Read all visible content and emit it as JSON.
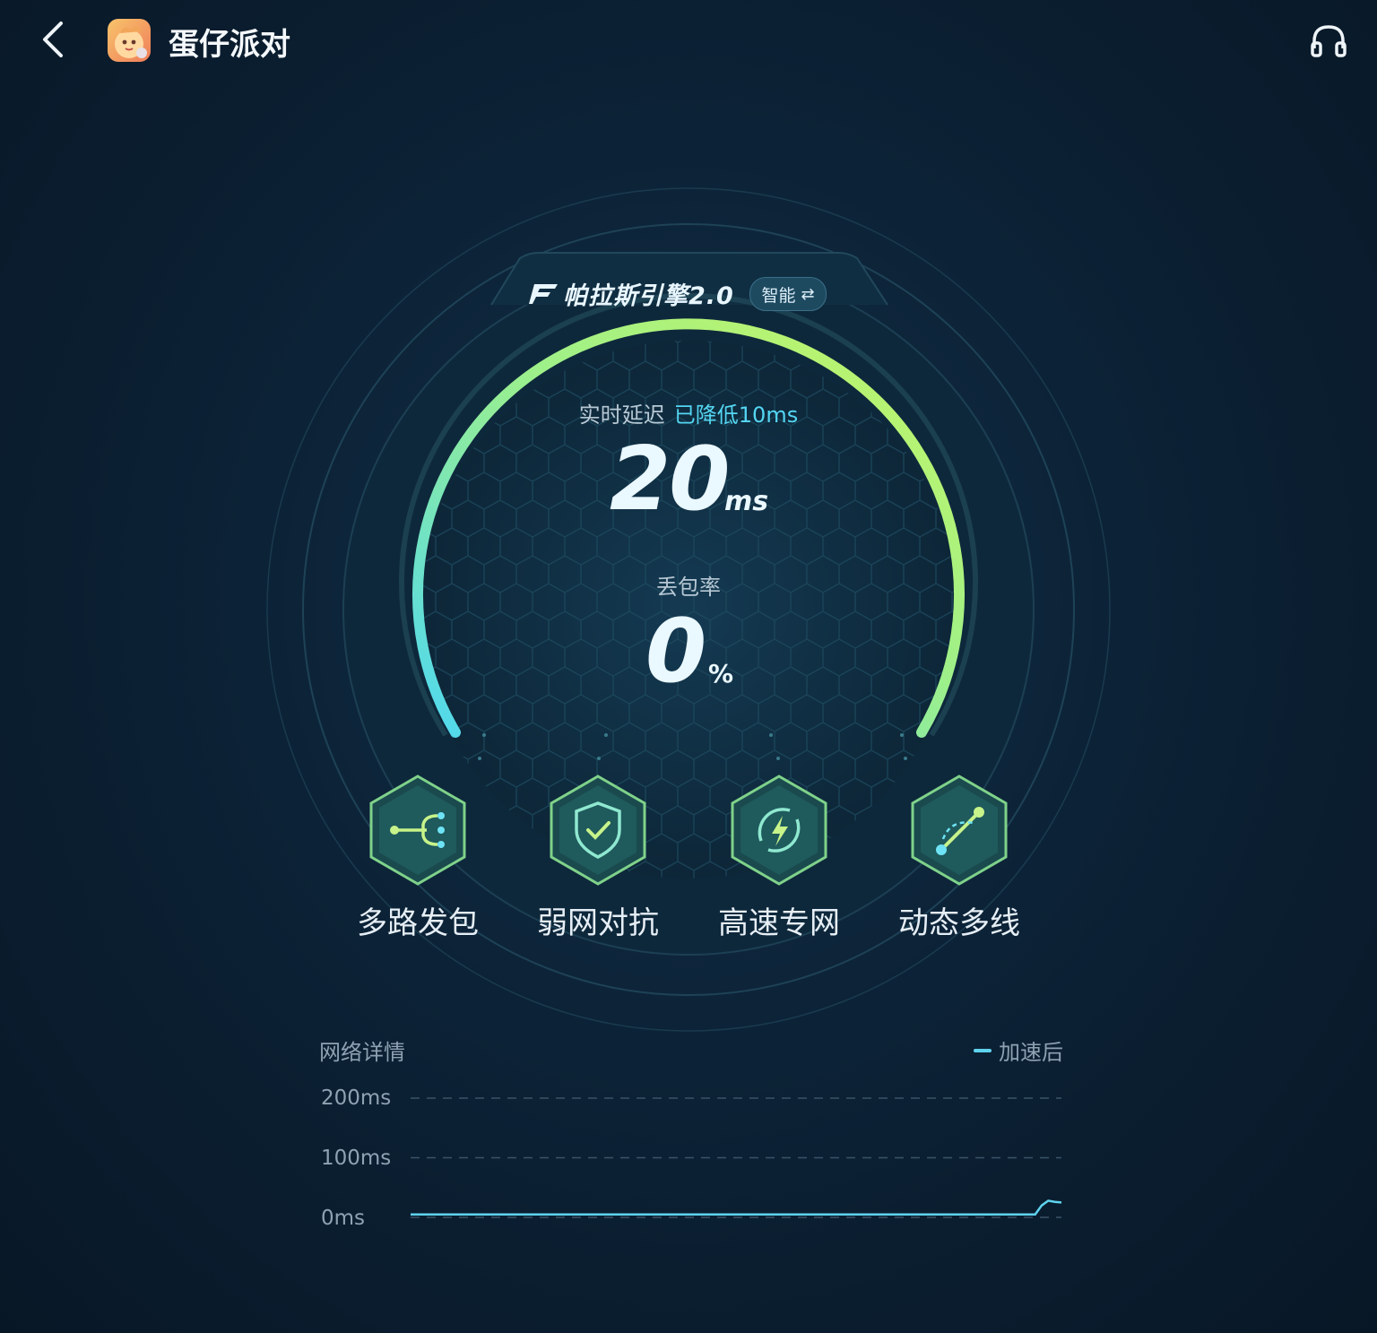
{
  "header": {
    "back_icon": "chevron-left-icon",
    "app_icon": "app-icon-egg-party",
    "title": "蛋仔派对",
    "support_icon": "headset-icon"
  },
  "engine": {
    "name": "帕拉斯引擎2.0",
    "mode": "智能",
    "mode_icon": "swap-arrows-icon"
  },
  "latency": {
    "label": "实时延迟",
    "reduced_text": "已降低10ms",
    "value": "20",
    "unit": "ms"
  },
  "packet_loss": {
    "label": "丢包率",
    "value": "0",
    "unit": "%"
  },
  "features": [
    {
      "label": "多路发包",
      "icon": "multipath-icon"
    },
    {
      "label": "弱网对抗",
      "icon": "shield-check-icon"
    },
    {
      "label": "高速专网",
      "icon": "lightning-icon"
    },
    {
      "label": "动态多线",
      "icon": "route-icon"
    }
  ],
  "colors": {
    "accent_cyan": "#54d6f2",
    "accent_green": "#b8f06a",
    "background": "#0c2236"
  },
  "network_details": {
    "title": "网络详情",
    "legend": "加速后",
    "chart_data": {
      "type": "line",
      "title": "网络详情",
      "ylabel": "",
      "y_ticks": [
        "200ms",
        "100ms",
        "0ms"
      ],
      "ylim": [
        0,
        200
      ],
      "grid": true,
      "legend_position": "top-right",
      "series": [
        {
          "name": "加速后",
          "color": "#5fd3ee",
          "values": [
            5,
            5,
            5,
            5,
            5,
            5,
            5,
            5,
            5,
            5,
            5,
            5,
            5,
            5,
            5,
            5,
            5,
            5,
            5,
            5,
            5,
            5,
            5,
            5,
            5,
            5,
            5,
            5,
            5,
            5,
            5,
            5,
            5,
            5,
            5,
            5,
            5,
            5,
            5,
            5,
            5,
            5,
            5,
            5,
            5,
            5,
            5,
            5,
            5,
            5,
            5,
            5,
            5,
            5,
            5,
            5,
            5,
            5,
            5,
            5,
            5,
            5,
            5,
            5,
            5,
            5,
            5,
            5,
            5,
            5,
            5,
            5,
            5,
            5,
            5,
            5,
            5,
            5,
            5,
            5,
            5,
            5,
            5,
            5,
            5,
            5,
            5,
            5,
            5,
            5,
            5,
            5,
            5,
            5,
            5,
            5,
            20,
            28,
            26,
            25
          ]
        }
      ]
    }
  }
}
